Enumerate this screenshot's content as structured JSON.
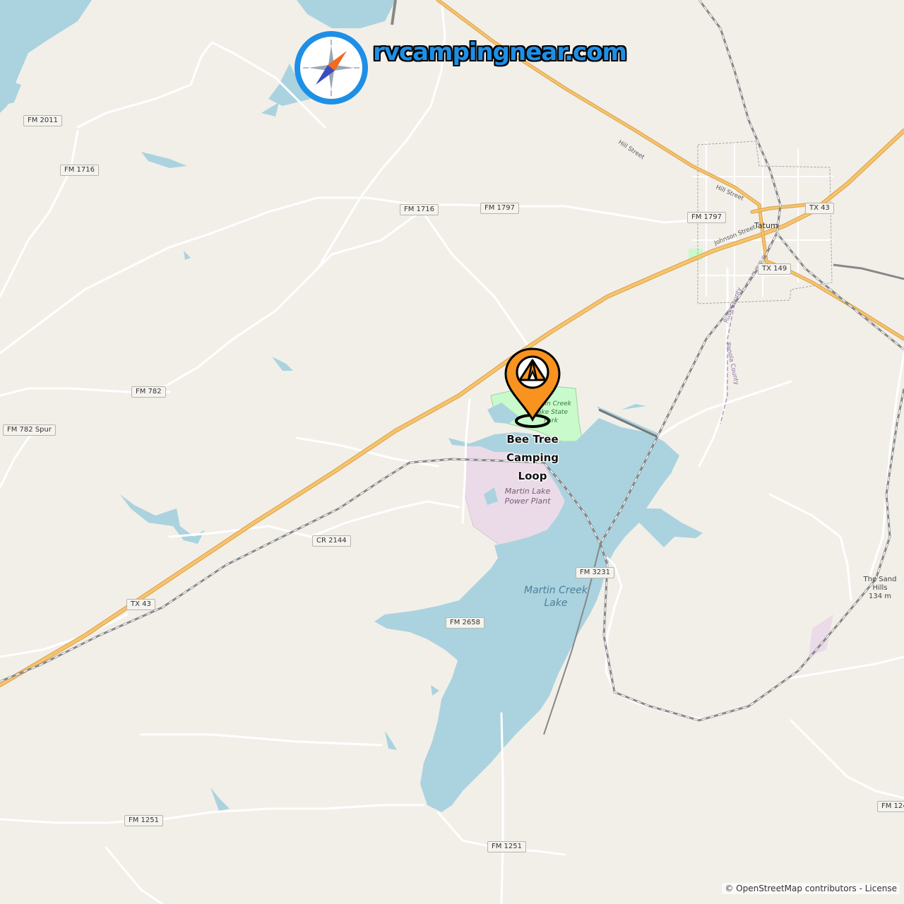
{
  "site": {
    "name": "rvcampingnear.com"
  },
  "marker": {
    "label": "Bee Tree Camping Loop",
    "icon": "tent-marker-icon",
    "color": "#f7931e"
  },
  "roads": {
    "fm2011": "FM 2011",
    "fm1716_west": "FM 1716",
    "fm1716_center": "FM 1716",
    "fm1797_center": "FM 1797",
    "fm1797_east": "FM 1797",
    "fm782": "FM 782",
    "fm782spur": "FM 782 Spur",
    "cr2144": "CR 2144",
    "tx43_west": "TX 43",
    "tx43_east": "TX 43",
    "tx149": "TX 149",
    "fm3231": "FM 3231",
    "fm2658": "FM 2658",
    "fm1251_west": "FM 1251",
    "fm1251_center": "FM 1251",
    "fm124x": "FM 124"
  },
  "streets": {
    "hill1": "Hill Street",
    "hill2": "Hill Street",
    "johnson": "Johnson Street",
    "tatum": "Tatum",
    "rusk_county": "Rusk County",
    "panola_county": "Panola County"
  },
  "features": {
    "lake": "Martin Creek Lake",
    "power_plant": "Martin Lake Power Plant",
    "state_park": "Martin Creek Lake State Park",
    "peak_name": "The Sand Hills",
    "peak_elev": "134 m"
  },
  "attribution": {
    "osm": "© OpenStreetMap contributors",
    "sep": " - ",
    "license": "License"
  },
  "colors": {
    "land": "#f2efe9",
    "water": "#aad3df",
    "major_road": "#f7c46c",
    "minor_road": "#ffffff",
    "rail": "#888888",
    "park": "#c8facc",
    "industrial": "#ebdbe8",
    "brand": "#1e8fe6"
  }
}
